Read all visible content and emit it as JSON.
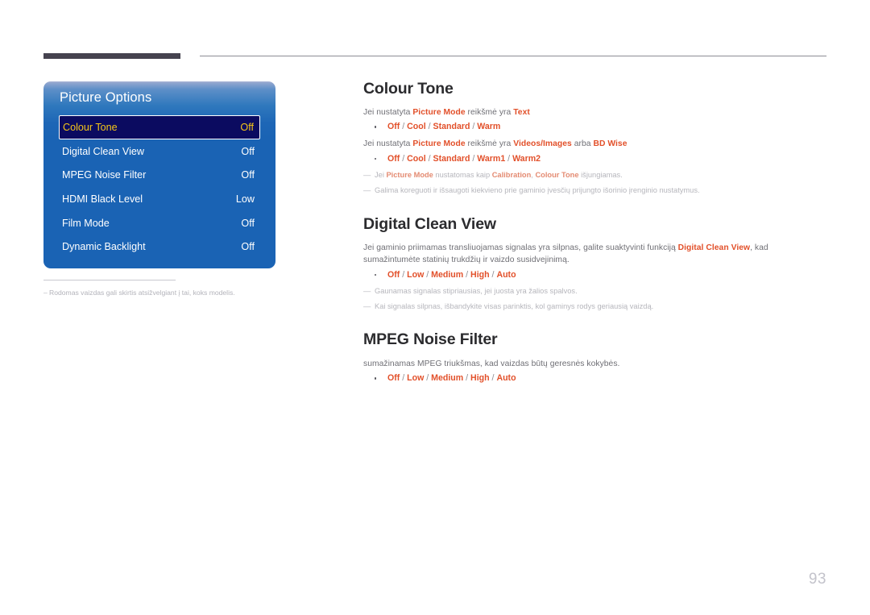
{
  "page": {
    "number": "93"
  },
  "osd": {
    "title": "Picture Options",
    "rows": [
      {
        "label": "Colour Tone",
        "value": "Off",
        "selected": true
      },
      {
        "label": "Digital Clean View",
        "value": "Off",
        "selected": false
      },
      {
        "label": "MPEG Noise Filter",
        "value": "Off",
        "selected": false
      },
      {
        "label": "HDMI Black Level",
        "value": "Low",
        "selected": false
      },
      {
        "label": "Film Mode",
        "value": "Off",
        "selected": false
      },
      {
        "label": "Dynamic Backlight",
        "value": "Off",
        "selected": false
      }
    ],
    "footnote_dash": "‒",
    "footnote": "Rodomas vaizdas gali skirtis atsižvelgiant į tai, koks modelis."
  },
  "sections": {
    "colour_tone": {
      "heading": "Colour Tone",
      "line1_pre": "Jei nustatyta ",
      "line1_kw1": "Picture Mode",
      "line1_mid": " reikšmė yra ",
      "line1_kw2": "Text",
      "options1": [
        "Off",
        "Cool",
        "Standard",
        "Warm"
      ],
      "line2_pre": "Jei nustatyta ",
      "line2_kw1": "Picture Mode",
      "line2_mid": " reikšmė yra ",
      "line2_kw2": "Videos/Images",
      "line2_mid2": " arba ",
      "line2_kw3": "BD Wise",
      "options2": [
        "Off",
        "Cool",
        "Standard",
        "Warm1",
        "Warm2"
      ],
      "note1_dash": "—",
      "note1_a": "Jei ",
      "note1_kw1": "Picture Mode",
      "note1_b": " nustatomas kaip ",
      "note1_kw2": "Calibration",
      "note1_c": ", ",
      "note1_kw3": "Colour Tone",
      "note1_d": " išjungiamas.",
      "note2_dash": "—",
      "note2": "Galima koreguoti ir išsaugoti kiekvieno prie gaminio įvesčių prijungto išorinio įrenginio nustatymus."
    },
    "digital_clean_view": {
      "heading": "Digital Clean View",
      "body_pre": "Jei gaminio priimamas transliuojamas signalas yra silpnas, galite suaktyvinti funkciją ",
      "body_kw": "Digital Clean View",
      "body_post": ", kad sumažintumėte statinių trukdžių ir vaizdo susidvejinimą.",
      "options": [
        "Off",
        "Low",
        "Medium",
        "High",
        "Auto"
      ],
      "note1_dash": "—",
      "note1": "Gaunamas signalas stipriausias, jei juosta yra žalios spalvos.",
      "note2_dash": "—",
      "note2": "Kai signalas silpnas, išbandykite visas parinktis, kol gaminys rodys geriausią vaizdą."
    },
    "mpeg_noise_filter": {
      "heading": "MPEG Noise Filter",
      "body": "sumažinamas MPEG triukšmas, kad vaizdas būtų geresnės kokybės.",
      "options": [
        "Off",
        "Low",
        "Medium",
        "High",
        "Auto"
      ]
    }
  },
  "colors": {
    "accent_orange": "#e2502a",
    "osd_blue": "#1a63b4",
    "osd_selected_bg": "#0b0b60",
    "osd_selected_text": "#f5c518",
    "heading": "#2b2b2e",
    "body_text": "#6f6f75",
    "note_text": "#b6b6bc",
    "header_bar": "#46434f"
  }
}
